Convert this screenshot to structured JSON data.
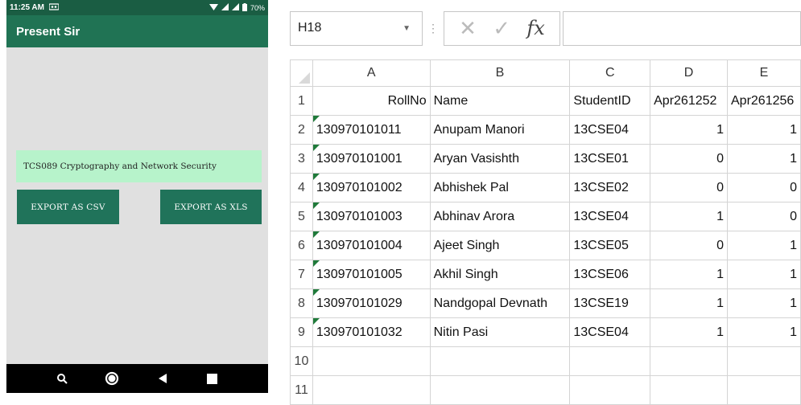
{
  "phone": {
    "status_bar": {
      "time": "11:25 AM",
      "battery": "70%"
    },
    "app_title": "Present Sir",
    "course_label": "TCS089 Cryptography and Network Security",
    "export_csv_label": "EXPORT AS CSV",
    "export_xls_label": "EXPORT AS XLS"
  },
  "excel": {
    "name_box": "H18",
    "formula_icons": {
      "cancel": "✕",
      "confirm": "✓",
      "fx": "fx"
    },
    "columns": [
      "A",
      "B",
      "C",
      "D",
      "E"
    ],
    "row_numbers": [
      "1",
      "2",
      "3",
      "4",
      "5",
      "6",
      "7",
      "8",
      "9",
      "10",
      "11"
    ],
    "header_row": [
      "RollNo",
      "Name",
      "StudentID",
      "Apr261252",
      "Apr261256"
    ],
    "rows": [
      [
        "130970101011",
        "Anupam Manori",
        "13CSE04",
        "1",
        "1"
      ],
      [
        "130970101001",
        "Aryan Vasishth",
        "13CSE01",
        "0",
        "1"
      ],
      [
        "130970101002",
        "Abhishek Pal",
        "13CSE02",
        "0",
        "0"
      ],
      [
        "130970101003",
        "Abhinav Arora",
        "13CSE04",
        "1",
        "0"
      ],
      [
        "130970101004",
        "Ajeet Singh",
        "13CSE05",
        "0",
        "1"
      ],
      [
        "130970101005",
        "Akhil Singh",
        "13CSE06",
        "1",
        "1"
      ],
      [
        "130970101029",
        "Nandgopal Devnath",
        "13CSE19",
        "1",
        "1"
      ],
      [
        "130970101032",
        "Nitin Pasi",
        "13CSE04",
        "1",
        "1"
      ]
    ]
  },
  "colors": {
    "status_bar": "#1a5d43",
    "app_bar": "#207354",
    "button": "#20735a",
    "course_box": "#b7f3cb",
    "error_triangle": "#1f7a3a"
  }
}
